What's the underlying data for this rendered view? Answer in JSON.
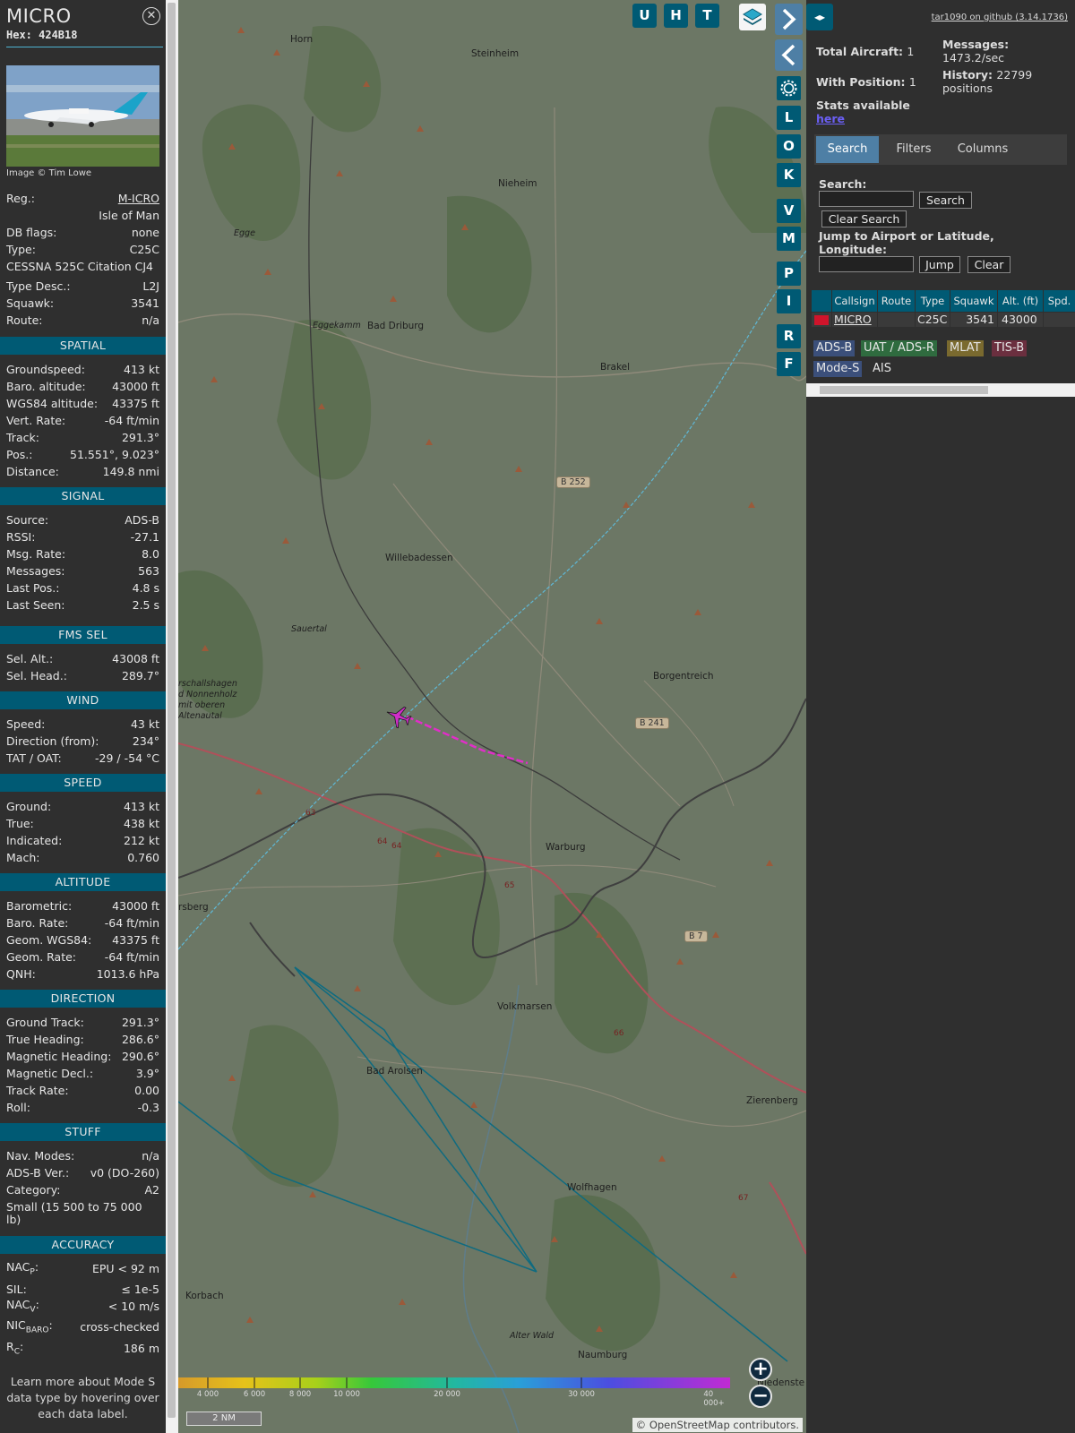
{
  "info": {
    "title": "MICRO",
    "hex": "Hex: 424B18",
    "close_icon": "✕",
    "photo_credit": "Image © Tim Lowe",
    "rows": {
      "reg_label": "Reg.:",
      "reg_value": "M-ICRO",
      "country": "Isle of Man",
      "dbflags_label": "DB flags:",
      "dbflags_value": "none",
      "type_label": "Type:",
      "type_value": "C25C",
      "type_full": "CESSNA 525C Citation CJ4",
      "typedesc_label": "Type Desc.:",
      "typedesc_value": "L2J",
      "squawk_label": "Squawk:",
      "squawk_value": "3541",
      "route_label": "Route:",
      "route_value": "n/a"
    },
    "sections": {
      "spatial": "SPATIAL",
      "signal": "SIGNAL",
      "fms": "FMS SEL",
      "wind": "WIND",
      "speed": "SPEED",
      "altitude": "ALTITUDE",
      "direction": "DIRECTION",
      "stuff": "STUFF",
      "accuracy": "ACCURACY"
    },
    "spatial": [
      {
        "l": "Groundspeed:",
        "v": "413 kt"
      },
      {
        "l": "Baro. altitude:",
        "v": "43000 ft"
      },
      {
        "l": "WGS84 altitude:",
        "v": "43375 ft"
      },
      {
        "l": "Vert. Rate:",
        "v": "-64 ft/min"
      },
      {
        "l": "Track:",
        "v": "291.3°"
      },
      {
        "l": "Pos.:",
        "v": "51.551°, 9.023°"
      },
      {
        "l": "Distance:",
        "v": "149.8 nmi"
      }
    ],
    "signal": [
      {
        "l": "Source:",
        "v": "ADS-B"
      },
      {
        "l": "RSSI:",
        "v": "-27.1"
      },
      {
        "l": "Msg. Rate:",
        "v": "8.0"
      },
      {
        "l": "Messages:",
        "v": "563"
      },
      {
        "l": "Last Pos.:",
        "v": "4.8 s"
      },
      {
        "l": "Last Seen:",
        "v": "2.5 s"
      }
    ],
    "fms": [
      {
        "l": "Sel. Alt.:",
        "v": "43008 ft"
      },
      {
        "l": "Sel. Head.:",
        "v": "289.7°"
      }
    ],
    "wind": [
      {
        "l": "Speed:",
        "v": "43 kt"
      },
      {
        "l": "Direction (from):",
        "v": "234°"
      },
      {
        "l": "TAT / OAT:",
        "v": "-29 / -54 °C"
      }
    ],
    "speed": [
      {
        "l": "Ground:",
        "v": "413 kt"
      },
      {
        "l": "True:",
        "v": "438 kt"
      },
      {
        "l": "Indicated:",
        "v": "212 kt"
      },
      {
        "l": "Mach:",
        "v": "0.760"
      }
    ],
    "altitude": [
      {
        "l": "Barometric:",
        "v": "43000 ft"
      },
      {
        "l": "Baro. Rate:",
        "v": "-64 ft/min"
      },
      {
        "l": "Geom. WGS84:",
        "v": "43375 ft"
      },
      {
        "l": "Geom. Rate:",
        "v": "-64 ft/min"
      },
      {
        "l": "QNH:",
        "v": "1013.6 hPa"
      }
    ],
    "direction": [
      {
        "l": "Ground Track:",
        "v": "291.3°"
      },
      {
        "l": "True Heading:",
        "v": "286.6°"
      },
      {
        "l": "Magnetic Heading:",
        "v": "290.6°"
      },
      {
        "l": "Magnetic Decl.:",
        "v": "3.9°"
      },
      {
        "l": "Track Rate:",
        "v": "0.00"
      },
      {
        "l": "Roll:",
        "v": "-0.3"
      }
    ],
    "stuff": [
      {
        "l": "Nav. Modes:",
        "v": "n/a"
      },
      {
        "l": "ADS-B Ver.:",
        "v": "v0 (DO-260)"
      },
      {
        "l": "Category:",
        "v": "A2"
      }
    ],
    "stuff_category_desc": "Small (15 500 to 75 000 lb)",
    "accuracy": {
      "nacp_label": "NAC",
      "nacp_sub": "P",
      "nacp_value": "EPU < 92 m",
      "sil_label": "SIL:",
      "sil_value": "≤ 1e-5",
      "nacv_label": "NAC",
      "nacv_sub": "V",
      "nacv_value": "< 10 m/s",
      "nicbaro_label": "NIC",
      "nicbaro_sub": "BARO",
      "nicbaro_value": "cross-checked",
      "rc_label": "R",
      "rc_sub": "C",
      "rc_value": "186 m"
    },
    "footer": "Learn more about Mode S data type by hovering over each data label."
  },
  "map": {
    "toolbar": [
      "U",
      "H",
      "T"
    ],
    "side_buttons": [
      "L",
      "O",
      "K",
      "V",
      "M",
      "P",
      "I",
      "R",
      "F"
    ],
    "towns": [
      {
        "name": "Horn"
      },
      {
        "name": "Steinheim"
      },
      {
        "name": "Nieheim"
      },
      {
        "name": "Egge"
      },
      {
        "name": "Eggekamm"
      },
      {
        "name": "Bad Driburg"
      },
      {
        "name": "Brakel"
      },
      {
        "name": "Willebadessen"
      },
      {
        "name": "Sauertal"
      },
      {
        "name": "Borgentreich"
      },
      {
        "name": "Warburg"
      },
      {
        "name": "rsberg"
      },
      {
        "name": "Volkmarsen"
      },
      {
        "name": "Bad Arolsen"
      },
      {
        "name": "Zierenberg"
      },
      {
        "name": "Wolfhagen"
      },
      {
        "name": "Korbach"
      },
      {
        "name": "Alter Wald"
      },
      {
        "name": "Naumburg"
      },
      {
        "name": "Niedenste"
      },
      {
        "name": "rschallshagen"
      },
      {
        "name": "d Nonnenholz"
      },
      {
        "name": "mit oberen"
      },
      {
        "name": "Altenautal"
      }
    ],
    "road_badges": [
      "B 252",
      "B 241",
      "B 7"
    ],
    "road_numbers": [
      "63",
      "64",
      "64",
      "65",
      "66",
      "67"
    ],
    "scale_labels": [
      "4 000",
      "6 000",
      "8 000",
      "10 000",
      "20 000",
      "30 000",
      "40 000+"
    ],
    "scale_distance": "2 NM",
    "attribution": "© OpenStreetMap contributors.",
    "zoom_in": "+",
    "zoom_out": "−"
  },
  "side": {
    "github": "tar1090 on github (3.14.1736)",
    "split_icon": "◂▸",
    "total_label": "Total Aircraft:",
    "total_value": "1",
    "withpos_label": "With Position:",
    "withpos_value": "1",
    "messages_label": "Messages:",
    "messages_value": "1473.2/sec",
    "history_label": "History:",
    "history_value": "22799 positions",
    "stats_label": "Stats available",
    "stats_link": "here",
    "tabs": [
      "Search",
      "Filters",
      "Columns"
    ],
    "search_label": "Search:",
    "search_btn": "Search",
    "clear_search_btn": "Clear Search",
    "jump_label": "Jump to Airport or Latitude, Longitude:",
    "jump_btn": "Jump",
    "clear_btn": "Clear",
    "table_headers": [
      "",
      "Callsign",
      "Route",
      "Type",
      "Squawk",
      "Alt. (ft)",
      "Spd."
    ],
    "table_row": {
      "callsign": "MICRO",
      "route": "",
      "type": "C25C",
      "squawk": "3541",
      "alt": "43000",
      "spd": ""
    },
    "badges": [
      {
        "label": "ADS-B",
        "color": "#3b4f7a"
      },
      {
        "label": "UAT / ADS-R",
        "color": "#2f6b3f"
      },
      {
        "label": "MLAT",
        "color": "#7a6a2f"
      },
      {
        "label": "TIS-B",
        "color": "#6b2f3f"
      },
      {
        "label": "Mode-S",
        "color": "#3b4f7a"
      },
      {
        "label": "AIS",
        "color": "#2f2f2f"
      }
    ]
  }
}
